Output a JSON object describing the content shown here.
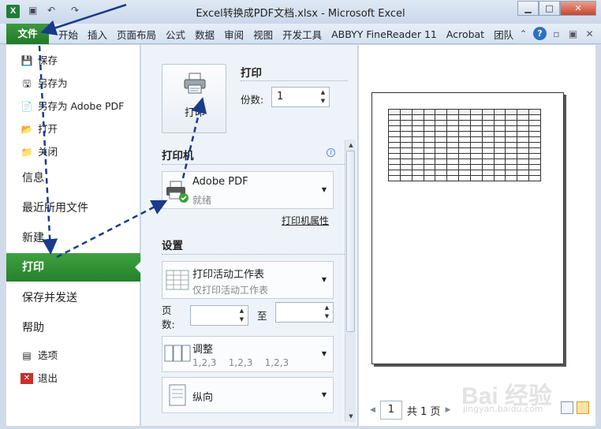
{
  "window": {
    "title": "Excel转换成PDF文档.xlsx - Microsoft Excel",
    "app_icon": "X"
  },
  "ribbon": {
    "file_tab": "文件",
    "tabs": [
      "开始",
      "插入",
      "页面布局",
      "公式",
      "数据",
      "审阅",
      "视图",
      "开发工具",
      "ABBYY FineReader 11",
      "Acrobat",
      "团队"
    ]
  },
  "backstage": {
    "commands": [
      {
        "icon": "save-icon",
        "label": "保存"
      },
      {
        "icon": "save-as-icon",
        "label": "另存为"
      },
      {
        "icon": "save-as-pdf-icon",
        "label": "另存为 Adobe PDF"
      },
      {
        "icon": "open-folder-icon",
        "label": "打开"
      },
      {
        "icon": "close-folder-icon",
        "label": "关闭"
      }
    ],
    "sections": [
      "信息",
      "最近所用文件",
      "新建"
    ],
    "active_section": "打印",
    "sections_after": [
      "保存并发送",
      "帮助"
    ],
    "bottom_commands": [
      {
        "icon": "options-icon",
        "label": "选项"
      },
      {
        "icon": "exit-icon",
        "label": "退出"
      }
    ]
  },
  "print": {
    "button_label": "打印",
    "heading": "打印",
    "copies_label": "份数:",
    "copies_value": "1",
    "printer_heading": "打印机",
    "printer_name": "Adobe PDF",
    "printer_status": "就绪",
    "printer_props": "打印机属性",
    "settings_heading": "设置",
    "scope_title": "打印活动工作表",
    "scope_sub": "仅打印活动工作表",
    "pages_label": "页数:",
    "to_label": "至",
    "collate_title": "调整",
    "collate_sub": "1,2,3    1,2,3    1,2,3",
    "orientation": "纵向"
  },
  "preview": {
    "page_current": "1",
    "page_total": "共 1 页"
  },
  "watermark": {
    "text": "Bai 经验",
    "sub": "jingyan.baidu.com"
  },
  "colors": {
    "accent_green": "#2e8b34",
    "arrow_blue": "#1a3a8a"
  }
}
